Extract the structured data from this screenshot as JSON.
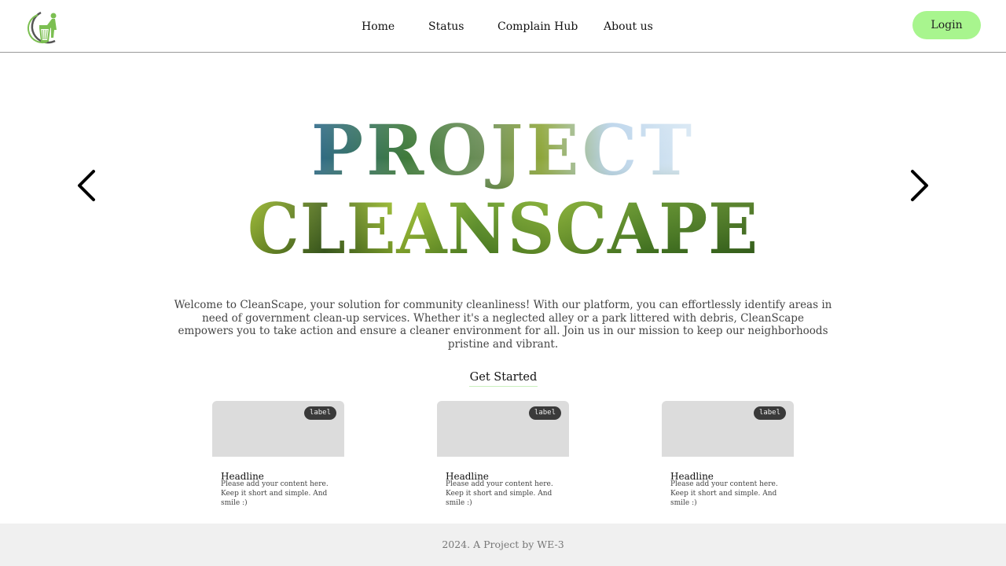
{
  "header": {
    "logo_icon": "trash-bin-person-icon",
    "nav": {
      "home": "Home",
      "status": "Status",
      "complain_hub": "Complain Hub",
      "about_us": "About us"
    },
    "login_label": "Login"
  },
  "hero": {
    "title_line1": "PROJECT",
    "title_line2": "CLEANSCAPE",
    "prev_icon": "chevron-left-icon",
    "next_icon": "chevron-right-icon",
    "description": "Welcome to CleanScape, your solution for community cleanliness! With our platform, you can effortlessly identify areas in need of government clean-up services. Whether it's a neglected alley or a park littered with debris, CleanScape empowers you to take action and ensure a cleaner environment for all. Join us in our mission to keep our neighborhoods pristine and vibrant.",
    "cta_label": "Get Started"
  },
  "cards": [
    {
      "label": "label",
      "headline": "Headline",
      "text": "Please add your content here. Keep it short and simple. And smile :)"
    },
    {
      "label": "label",
      "headline": "Headline",
      "text": "Please add your content here. Keep it short and simple. And smile :)"
    },
    {
      "label": "label",
      "headline": "Headline",
      "text": "Please add your content here. Keep it short and simple. And smile :)"
    }
  ],
  "footer": {
    "text": "2024. A Project by WE-3"
  },
  "colors": {
    "login_bg": "#a8f58e",
    "card_placeholder": "#dcdcdc",
    "label_bg": "#3a3a3a",
    "footer_bg": "#f0f0f0",
    "text_green_dark": "#2e6b1e",
    "text_green_light": "#9fc52a",
    "text_sky": "#3a6e9e"
  }
}
